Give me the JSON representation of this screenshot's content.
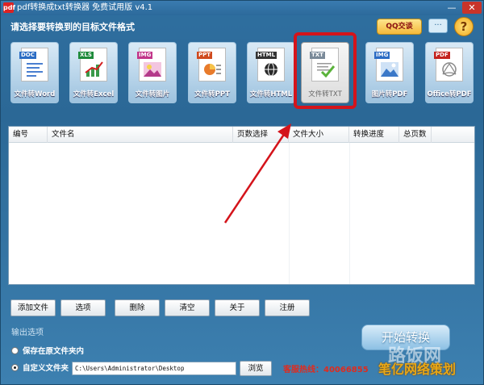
{
  "window": {
    "title": "pdf转换成txt转换器 免费试用版 v4.1",
    "app_icon": "pdf",
    "minimize_glyph": "—",
    "close_glyph": "✕"
  },
  "header": {
    "subtitle": "请选择要转换到的目标文件格式",
    "qq_button": "QQ交谈",
    "chat_icon": "chat-bubble-icon",
    "help_icon": "?"
  },
  "converters": [
    {
      "tag": "DOC",
      "label": "文件转Word",
      "tag_color": "#2b6cc4"
    },
    {
      "tag": "XLS",
      "label": "文件转Excel",
      "tag_color": "#1e8a3a"
    },
    {
      "tag": "IMG",
      "label": "文件转图片",
      "tag_color": "#c2368a"
    },
    {
      "tag": "PPT",
      "label": "文件转PPT",
      "tag_color": "#d04a1e"
    },
    {
      "tag": "HTML",
      "label": "文件转HTML",
      "tag_color": "#333333"
    },
    {
      "tag": "TXT",
      "label": "文件转TXT",
      "tag_color": "#7a8a99"
    },
    {
      "tag": "IMG",
      "label": "图片转PDF",
      "tag_color": "#2b6cc4"
    },
    {
      "tag": "PDF",
      "label": "Office转PDF",
      "tag_color": "#c4231e"
    }
  ],
  "selected_converter": "文件转TXT",
  "file_list": {
    "columns": [
      "编号",
      "文件名",
      "页数选择",
      "文件大小",
      "转换进度",
      "总页数"
    ],
    "rows": []
  },
  "toolbar": {
    "add_file": "添加文件",
    "options": "选项",
    "delete": "删除",
    "clear": "清空",
    "about": "关于",
    "register": "注册"
  },
  "output": {
    "title": "输出选项",
    "save_original": "保存在原文件夹内",
    "custom_folder": "自定义文件夹",
    "path": "C:\\Users\\Administrator\\Desktop",
    "browse": "浏览",
    "hotline": "客服热线：40066855",
    "selected": "custom_folder"
  },
  "start_button": "开始转换",
  "watermark": {
    "line1": "路饭网",
    "line2": "笔亿网络策划"
  },
  "colors": {
    "window_blue": "#2b6896",
    "highlight_red": "#d4141b",
    "hotline_red": "#e02b1e"
  }
}
